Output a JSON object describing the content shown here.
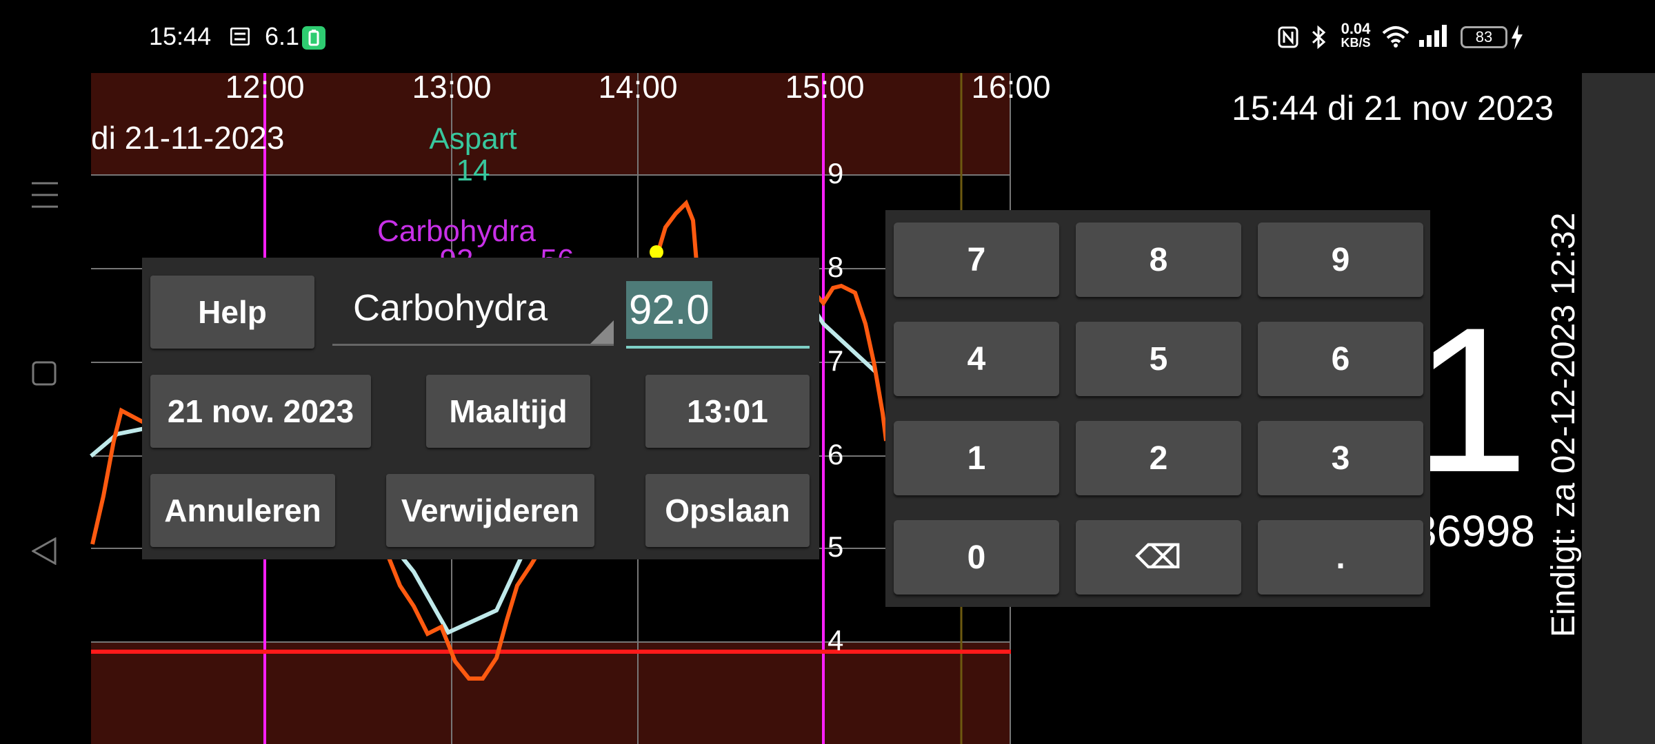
{
  "status_bar": {
    "time": "15:44",
    "msg_count": "6.1",
    "net_speed": "0.04",
    "net_unit": "KB/S",
    "battery": "83"
  },
  "graph": {
    "date_label": "di 21-11-2023",
    "time_ticks": [
      "12:00",
      "13:00",
      "14:00",
      "15:00",
      "16:00"
    ],
    "y_ticks": [
      "9",
      "8",
      "7",
      "6",
      "5",
      "4"
    ],
    "insulin_label": "Aspart",
    "insulin_value": "14",
    "carb_label": "Carbohydra",
    "carb_value_partial_1": "92",
    "carb_value_partial_2": "56",
    "colors": {
      "background_band": "#3d0f09",
      "sensor_line": "#ff5a10",
      "scan_line": "#bfe9ea",
      "low_line": "#ff1a1a",
      "marker_line": "#ff20ff",
      "insulin_text": "#38c79d",
      "carb_text": "#c830e8"
    }
  },
  "dialog": {
    "help_label": "Help",
    "type_value": "Carbohydra",
    "amount_value": "92.0",
    "date_label": "21 nov. 2023",
    "meal_label": "Maaltijd",
    "time_label": "13:01",
    "cancel_label": "Annuleren",
    "delete_label": "Verwijderen",
    "save_label": "Opslaan"
  },
  "keypad": {
    "keys": [
      "7",
      "8",
      "9",
      "4",
      "5",
      "6",
      "1",
      "2",
      "3",
      "0",
      "⌫",
      "."
    ]
  },
  "right_panel": {
    "datetime": "15:44 di 21 nov 2023",
    "big_value": "1",
    "number_fragment": "36998",
    "ends_label": "Eindigt: za 02-12-2023 12:32"
  }
}
